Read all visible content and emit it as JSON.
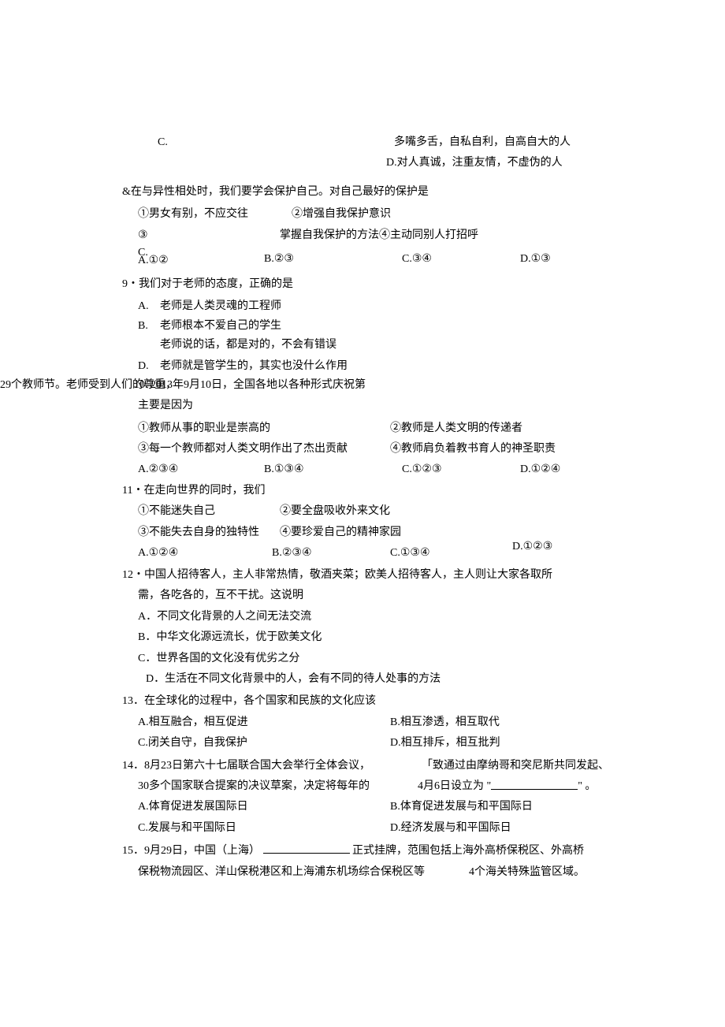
{
  "q7": {
    "option_c_prefix": "C.",
    "option_c_text": "多嘴多舌，自私自利，自高自大的人",
    "option_d": "D.对人真诚，注重友情，不虚伪的人"
  },
  "q8": {
    "stem": "&在与异性相处时，我们要学会保护自己。对自己最好的保护是",
    "item1": "①男女有别，不应交往",
    "item2": "②增强自我保护意识",
    "item3_prefix": "③",
    "item3_rest": "掌握自我保护的方法④主动同别人打招呼",
    "c_label": "C.",
    "opt_a": "A.①②",
    "opt_b": "B.②③",
    "opt_c": "C.③④",
    "opt_d": "D.①③"
  },
  "q9": {
    "stem": "9・我们对于老师的态度，正确的是",
    "letter_a": "A.",
    "text_a": "老师是人类灵魂的工程师",
    "letter_b": "B.",
    "text_b": "老师根本不爱自己的学生",
    "text_c_extra": "老师说的话，都是对的，不会有错误",
    "letter_d": "D.",
    "text_d": "老师就是管学生的，其实也没什么作用"
  },
  "q10": {
    "side_text": "29个教师节。老师受到人们的尊重，",
    "stem_line": "10. 2013年9月10日，全国各地以各种形式庆祝第",
    "line2": "主要是因为",
    "item1": "①教师从事的职业是崇高的",
    "item2": "②教师是人类文明的传递者",
    "item3": "③每一个教师都对人类文明作出了杰出贡献",
    "item4": "④教师肩负着教书育人的神圣职责",
    "opt_a": "A.②③④",
    "opt_b": "B.①③④",
    "opt_c": "C.①②③",
    "opt_d": "D.①②④"
  },
  "q11": {
    "stem": "11・在走向世界的同时，我们",
    "item1": "①不能迷失自己",
    "item2": "②要全盘吸收外来文化",
    "item3": "③不能失去自身的独特性",
    "item4": "④要珍爱自己的精神家园",
    "opt_a": "A.①②④",
    "opt_b": "B.②③④",
    "opt_c": "C.①③④",
    "opt_d": "D.①②③"
  },
  "q12": {
    "stem_l1": "12・中国人招待客人，主人非常热情，敬酒夹菜；欧美人招待客人，主人则让大家各取所",
    "stem_l2": "需，各吃各的，互不干扰。这说明",
    "opt_a": "A．不同文化背景的人之间无法交流",
    "opt_b": "B．中华文化源远流长，优于欧美文化",
    "opt_c": "C．世界各国的文化没有优劣之分",
    "opt_d": "D．生活在不同文化背景中的人，会有不同的待人处事的方法"
  },
  "q13": {
    "stem": "13．在全球化的过程中，各个国家和民族的文化应该",
    "opt_a": "A.相互融合，相互促进",
    "opt_b": "B.相互渗透，相互取代",
    "opt_c": "C.闭关自守，自我保护",
    "opt_d": "D.相互排斥，相互批判"
  },
  "q14": {
    "stem_l1_left": "14．8月23日第六十七届联合国大会举行全体会议，",
    "stem_l1_right": "「致通过由摩纳哥和突尼斯共同发起、",
    "stem_l2_left": "30多个国家联合提案的决议草案，决定将每年的",
    "stem_l2_mid": "4月6日设立为 \"",
    "stem_l2_end": "\" 。",
    "opt_a": "A.体育促进发展国际日",
    "opt_b": "B.体育促进发展与和平国际日",
    "opt_c": "C.发展与和平国际日",
    "opt_d": "D.经济发展与和平国际日"
  },
  "q15": {
    "stem_l1_pre": "15．9月29日，中国（上海）",
    "stem_l1_post": " 正式挂牌，范围包括上海外高桥保税区、外高桥",
    "stem_l2_left": "保税物流园区、洋山保税港区和上海浦东机场综合保税区等",
    "stem_l2_right": "4个海关特殊监管区域。"
  }
}
